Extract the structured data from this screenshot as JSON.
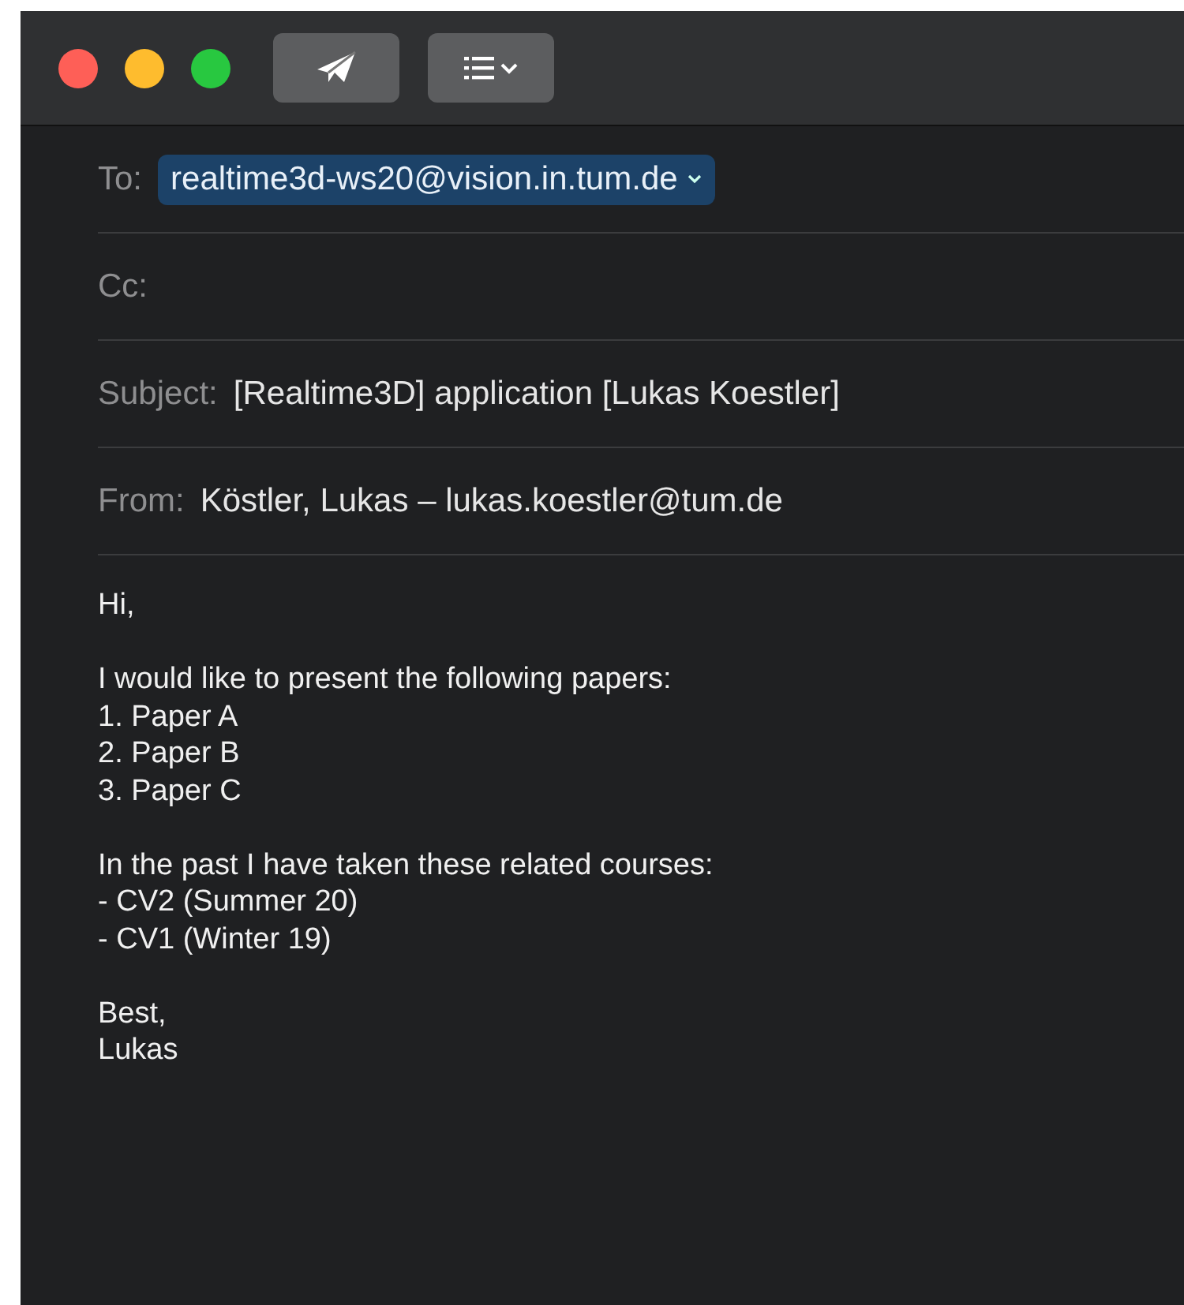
{
  "toolbar": {
    "buttons": [
      {
        "kind": "send"
      },
      {
        "kind": "list"
      }
    ]
  },
  "headers": [
    {
      "label": "To:",
      "kind": "recipient",
      "value": "realtime3d-ws20@vision.in.tum.de"
    },
    {
      "label": "Cc:",
      "kind": "empty"
    },
    {
      "label": "Subject:",
      "kind": "text",
      "value": "[Realtime3D] application [Lukas Koestler]"
    },
    {
      "label": "From:",
      "kind": "text",
      "value": "Köstler, Lukas – lukas.koestler@tum.de"
    }
  ],
  "body": [
    [
      "Hi,"
    ],
    [
      "I would like to present the following papers:",
      "1. Paper A",
      "2. Paper B",
      "3. Paper C"
    ],
    [
      "In the past I have taken these related courses:",
      "- CV2 (Summer 20)",
      "- CV1 (Winter 19)"
    ],
    [
      "Best,",
      "Lukas"
    ]
  ]
}
